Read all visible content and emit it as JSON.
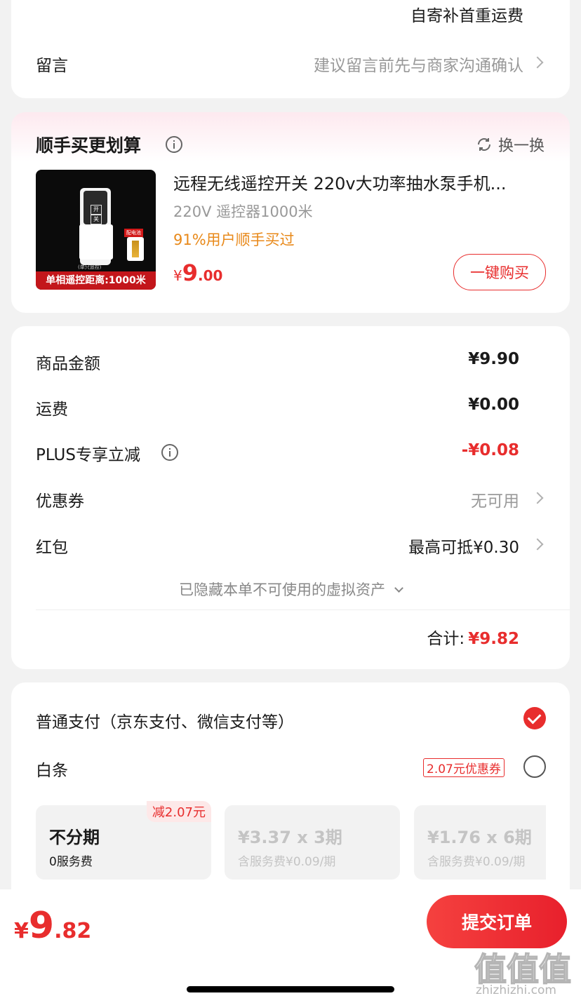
{
  "address_card": {
    "shipping_note": "自寄补首重运费",
    "message_label": "留言",
    "message_placeholder": "建议留言前先与商家沟通确认"
  },
  "upsell": {
    "title": "顺手买更划算",
    "refresh_label": "换一换",
    "product": {
      "name": "远程无线遥控开关 220v大功率抽水泵手机...",
      "spec": "220V 遥控器1000米",
      "social_proof": "91%用户顺手买过",
      "currency": "¥",
      "price_int": "9",
      "price_dec": ".00",
      "image_banner": "单相遥控距离:1000米",
      "image_icon_open": "开",
      "image_icon_close": "关",
      "image_caption": "(单只遥控)",
      "image_battery_tag": "配电池"
    },
    "buy_button": "一键购买"
  },
  "summary": {
    "rows": [
      {
        "label": "商品金额",
        "value": "¥9.90"
      },
      {
        "label": "运费",
        "value": "¥0.00"
      },
      {
        "label": "PLUS专享立减",
        "value": "-¥0.08"
      },
      {
        "label": "优惠券",
        "value": "无可用"
      },
      {
        "label": "红包",
        "value": "最高可抵¥0.30"
      }
    ],
    "hidden_assets": "已隐藏本单不可使用的虚拟资产",
    "total_label": "合计:",
    "total_value": "¥9.82"
  },
  "payment": {
    "normal_label": "普通支付（京东支付、微信支付等）",
    "baitiao_label": "白条",
    "baitiao_coupon": "2.07元优惠券",
    "plans": [
      {
        "title": "不分期",
        "subtitle": "0服务费",
        "badge": "减2.07元"
      },
      {
        "title": "¥3.37 x 3期",
        "subtitle": "含服务费¥0.09/期"
      },
      {
        "title": "¥1.76 x 6期",
        "subtitle": "含服务费¥0.09/期"
      }
    ]
  },
  "footer": {
    "currency": "¥",
    "price_int": "9",
    "price_dec": ".82",
    "submit_label": "提交订单",
    "watermark": "值值值",
    "watermark_url": "zhizhizhi.com"
  },
  "colors": {
    "accent": "#e82d2d",
    "orange": "#e8891a"
  }
}
